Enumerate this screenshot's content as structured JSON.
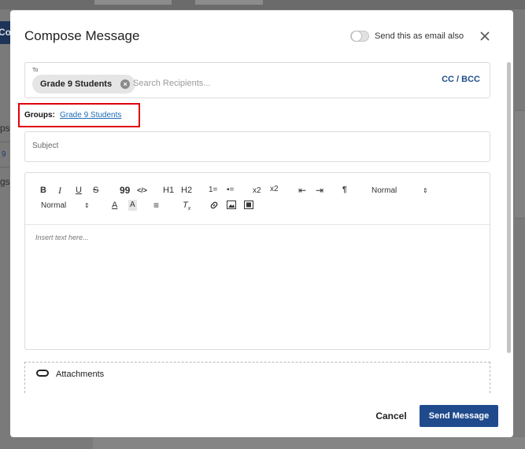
{
  "background": {
    "tab_label_fragment": "Co",
    "side_fragments": [
      "ps",
      "9",
      "gs"
    ]
  },
  "modal": {
    "title": "Compose Message",
    "email_toggle_label": "Send this as email also",
    "close_icon": "close-icon"
  },
  "to_field": {
    "label": "To",
    "chips": [
      "Grade 9 Students"
    ],
    "search_placeholder": "Search Recipients...",
    "cc_bcc_label": "CC / BCC"
  },
  "groups": {
    "label": "Groups:",
    "link": "Grade 9 Students"
  },
  "subject": {
    "placeholder": "Subject"
  },
  "editor": {
    "toolbar": {
      "bold": "B",
      "italic": "I",
      "underline": "U",
      "strike": "S",
      "quote": "99",
      "code": "</>",
      "h1": "H1",
      "h2": "H2",
      "ordered_list": "1=",
      "bullet_list": "•=",
      "subscript": "x2",
      "superscript": "x2",
      "indent_decrease": "⇤",
      "indent_increase": "⇥",
      "direction": "¶",
      "font_size_select": "Normal",
      "header_select": "Normal"
    },
    "placeholder": "Insert text here..."
  },
  "attachments": {
    "label": "Attachments"
  },
  "footer": {
    "cancel_label": "Cancel",
    "send_label": "Send Message"
  },
  "colors": {
    "primary": "#1f4a8c",
    "link": "#1e6bb8",
    "highlight_border": "#e0000d"
  }
}
